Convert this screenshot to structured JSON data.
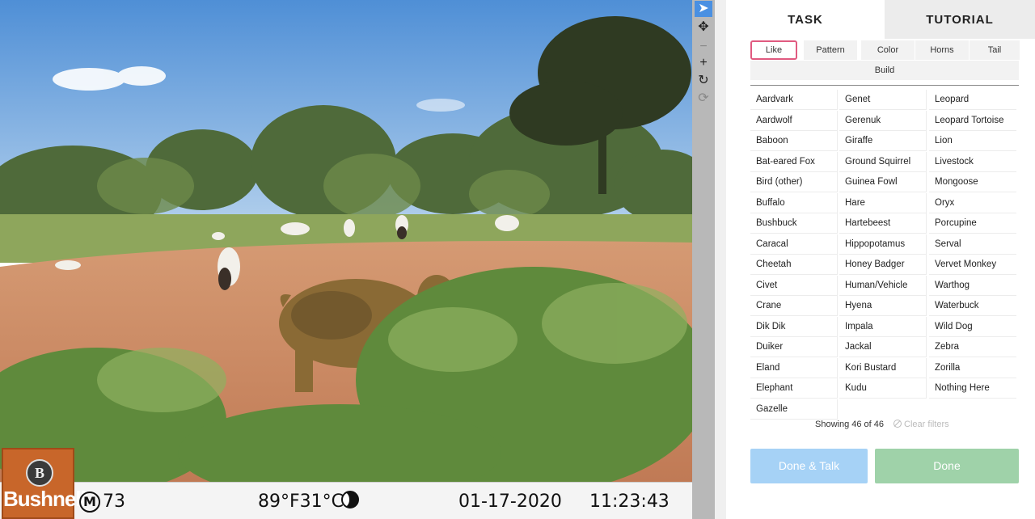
{
  "camera": {
    "brand": "Bushnell",
    "emblem": "B",
    "moon_phase_icon": "moon-phase-icon",
    "readout_label": "M",
    "readout_value": "73",
    "temperature": "89°F31°C",
    "date": "01-17-2020",
    "time": "11:23:43"
  },
  "toolbar": [
    {
      "name": "annotate-tool",
      "icon": "pointer-arrow-icon",
      "glyph": "➤",
      "state": "active"
    },
    {
      "name": "pan-tool",
      "icon": "move-arrows-icon",
      "glyph": "✥",
      "state": "normal"
    },
    {
      "name": "zoom-out-tool",
      "icon": "minus-icon",
      "glyph": "−",
      "state": "disabled"
    },
    {
      "name": "zoom-in-tool",
      "icon": "plus-icon",
      "glyph": "+",
      "state": "normal"
    },
    {
      "name": "rotate-tool",
      "icon": "rotate-icon",
      "glyph": "↻",
      "state": "normal"
    },
    {
      "name": "reset-tool",
      "icon": "reset-icon",
      "glyph": "⟳",
      "state": "disabled"
    }
  ],
  "tabs": {
    "task": "TASK",
    "tutorial": "TUTORIAL"
  },
  "filters": [
    {
      "label": "Like",
      "active": true
    },
    {
      "label": "Pattern",
      "active": false
    },
    {
      "label": "Color",
      "active": false
    },
    {
      "label": "Horns",
      "active": false
    },
    {
      "label": "Tail",
      "active": false
    },
    {
      "label": "Build",
      "active": false
    }
  ],
  "choices": {
    "column1": [
      "Aardvark",
      "Aardwolf",
      "Baboon",
      "Bat-eared Fox",
      "Bird (other)",
      "Buffalo",
      "Bushbuck",
      "Caracal",
      "Cheetah",
      "Civet",
      "Crane",
      "Dik Dik",
      "Duiker",
      "Eland",
      "Elephant",
      "Gazelle"
    ],
    "column2": [
      "Genet",
      "Gerenuk",
      "Giraffe",
      "Ground Squirrel",
      "Guinea Fowl",
      "Hare",
      "Hartebeest",
      "Hippopotamus",
      "Honey Badger",
      "Human/Vehicle",
      "Hyena",
      "Impala",
      "Jackal",
      "Kori Bustard",
      "Kudu"
    ],
    "column3": [
      "Leopard",
      "Leopard Tortoise",
      "Lion",
      "Livestock",
      "Mongoose",
      "Oryx",
      "Porcupine",
      "Serval",
      "Vervet Monkey",
      "Warthog",
      "Waterbuck",
      "Wild Dog",
      "Zebra",
      "Zorilla",
      "Nothing Here"
    ]
  },
  "status": {
    "showing": "Showing 46 of 46",
    "clear_filters": "Clear filters"
  },
  "actions": {
    "done_talk": "Done & Talk",
    "done": "Done"
  },
  "colors": {
    "active_tool": "#4a90e2",
    "active_filter_border": "#e05a80",
    "done_talk_button": "#a6d2f6",
    "done_button": "#9fd2a9",
    "logo_orange": "#c8662a"
  }
}
